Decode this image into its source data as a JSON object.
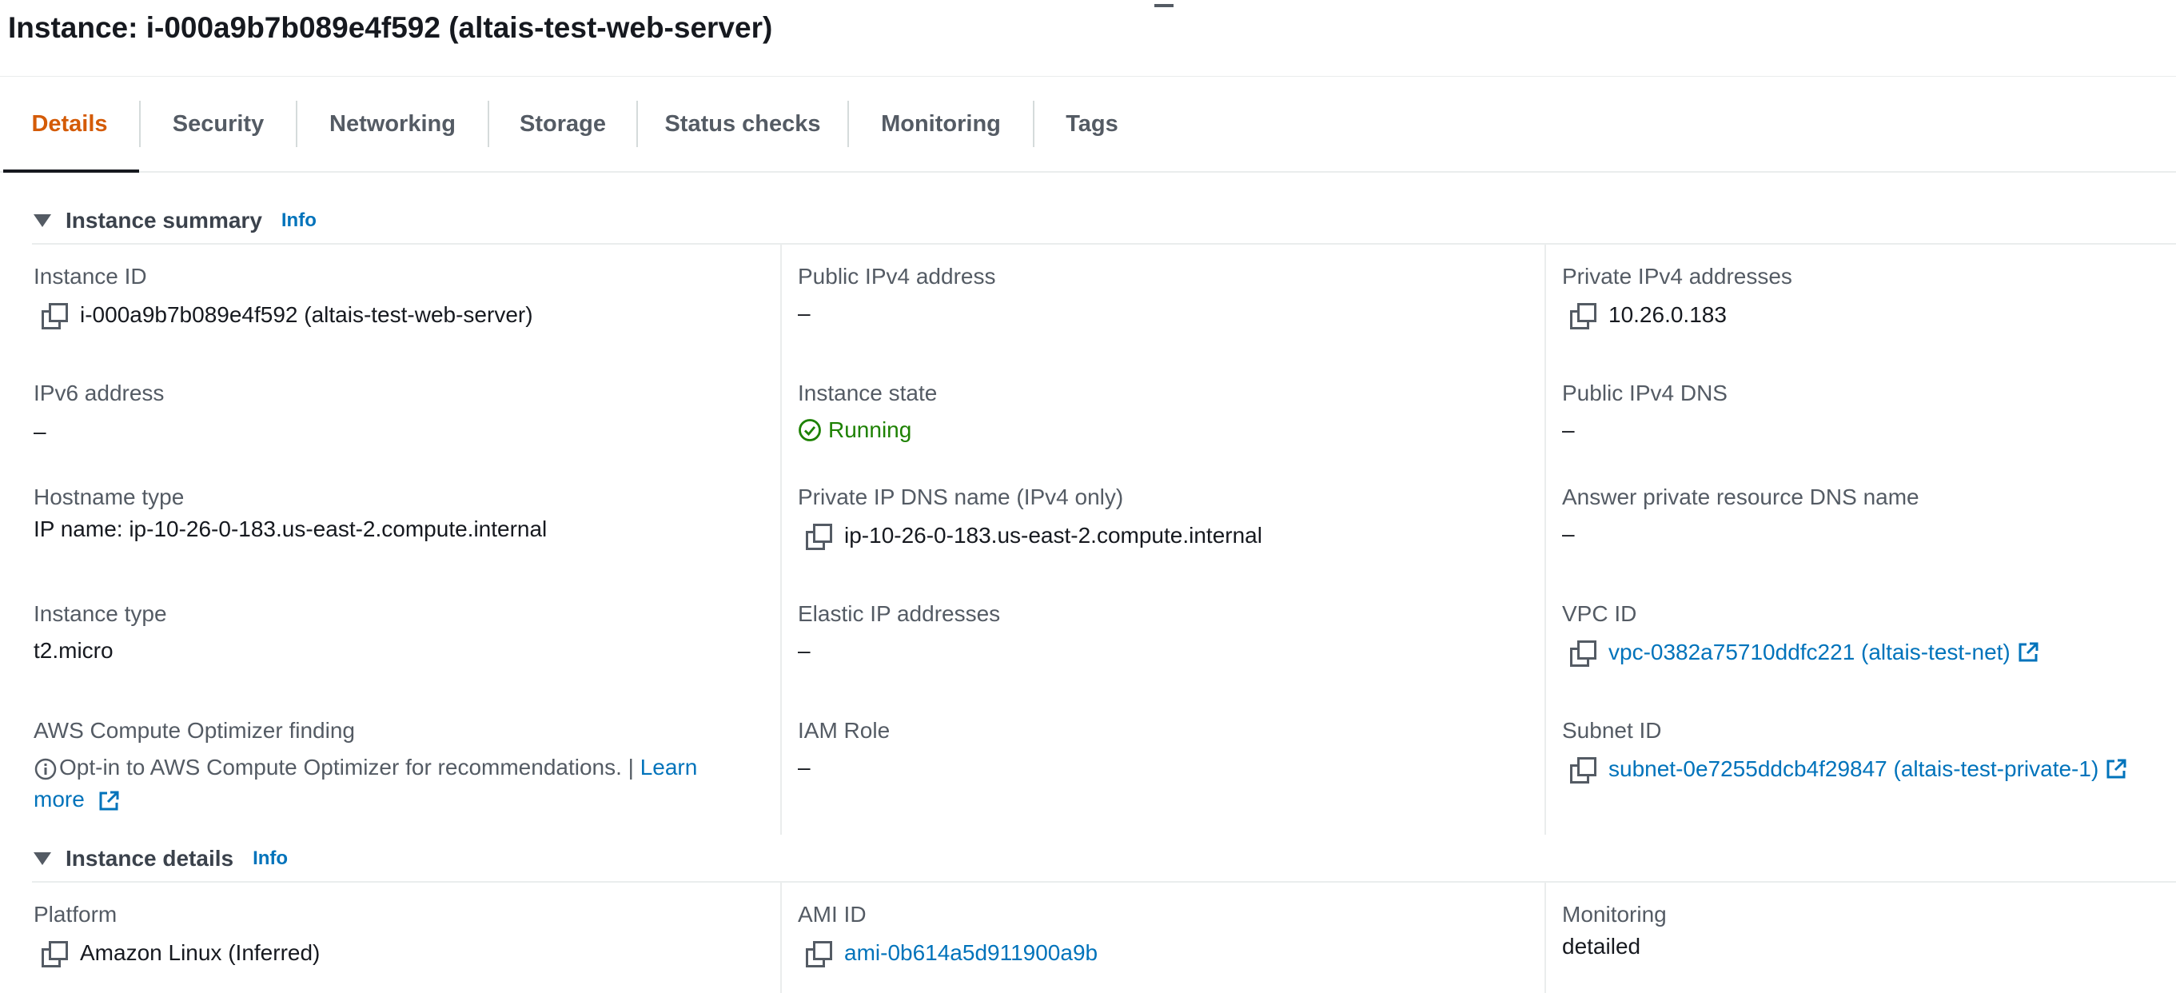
{
  "page": {
    "title": "Instance: i-000a9b7b089e4f592 (altais-test-web-server)"
  },
  "tabs": [
    {
      "label": "Details",
      "active": true
    },
    {
      "label": "Security"
    },
    {
      "label": "Networking"
    },
    {
      "label": "Storage"
    },
    {
      "label": "Status checks"
    },
    {
      "label": "Monitoring"
    },
    {
      "label": "Tags"
    }
  ],
  "summary": {
    "header": "Instance summary",
    "info": "Info",
    "instance_id": {
      "label": "Instance ID",
      "value": "i-000a9b7b089e4f592 (altais-test-web-server)"
    },
    "public_ipv4": {
      "label": "Public IPv4 address",
      "value": "–"
    },
    "private_ipv4": {
      "label": "Private IPv4 addresses",
      "value": "10.26.0.183"
    },
    "ipv6": {
      "label": "IPv6 address",
      "value": "–"
    },
    "instance_state": {
      "label": "Instance state",
      "value": "Running"
    },
    "public_dns": {
      "label": "Public IPv4 DNS",
      "value": "–"
    },
    "hostname_type": {
      "label": "Hostname type",
      "value": "IP name: ip-10-26-0-183.us-east-2.compute.internal"
    },
    "private_dns": {
      "label": "Private IP DNS name (IPv4 only)",
      "value": "ip-10-26-0-183.us-east-2.compute.internal"
    },
    "answer_dns": {
      "label": "Answer private resource DNS name",
      "value": "–"
    },
    "instance_type": {
      "label": "Instance type",
      "value": "t2.micro"
    },
    "elastic_ip": {
      "label": "Elastic IP addresses",
      "value": "–"
    },
    "vpc_id": {
      "label": "VPC ID",
      "value": "vpc-0382a75710ddfc221 (altais-test-net)"
    },
    "optimizer": {
      "label": "AWS Compute Optimizer finding",
      "text": "Opt-in to AWS Compute Optimizer for recommendations. | ",
      "link": "Learn more"
    },
    "iam_role": {
      "label": "IAM Role",
      "value": "–"
    },
    "subnet_id": {
      "label": "Subnet ID",
      "value": "subnet-0e7255ddcb4f29847 (altais-test-private-1)"
    }
  },
  "details": {
    "header": "Instance details",
    "info": "Info",
    "platform": {
      "label": "Platform",
      "value": "Amazon Linux (Inferred)"
    },
    "ami_id": {
      "label": "AMI ID",
      "value": "ami-0b614a5d911900a9b"
    },
    "monitoring": {
      "label": "Monitoring",
      "value": "detailed"
    }
  },
  "colors": {
    "accent_tab": "#d45b07",
    "link": "#0073bb",
    "running": "#1d8102",
    "text": "#16191f",
    "label": "#545b64"
  }
}
